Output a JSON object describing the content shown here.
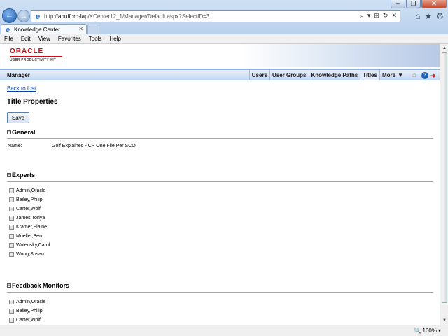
{
  "browser": {
    "url_prefix": "http://",
    "url_host": "ahufford-lap",
    "url_path": "/KCenter12_1/Manager/Default.aspx?SelectID=3",
    "tab_title": "Knowledge Center",
    "menu": [
      "File",
      "Edit",
      "View",
      "Favorites",
      "Tools",
      "Help"
    ],
    "zoom": "100%"
  },
  "banner": {
    "brand": "ORACLE",
    "product": "USER PRODUCTIVITY KIT"
  },
  "header": {
    "title": "Manager",
    "nav": [
      "Users",
      "User Groups",
      "Knowledge Paths",
      "Titles",
      "More"
    ],
    "active": "Titles"
  },
  "page": {
    "back_link": "Back to List",
    "title": "Title Properties",
    "save_label": "Save"
  },
  "general": {
    "heading": "General",
    "name_label": "Name:",
    "name_value": "Golf Explained - CP One File Per SCO"
  },
  "experts": {
    "heading": "Experts",
    "items": [
      "Admin,Oracle",
      "Bailey,Philip",
      "Carter,Wolf",
      "James,Tonya",
      "Kramer,Elaine",
      "Moeller,Ben",
      "Wolensky,Carol",
      "Wong,Susan"
    ]
  },
  "feedback": {
    "heading": "Feedback Monitors",
    "items": [
      "Admin,Oracle",
      "Bailey,Philip",
      "Carter,Wolf"
    ]
  }
}
